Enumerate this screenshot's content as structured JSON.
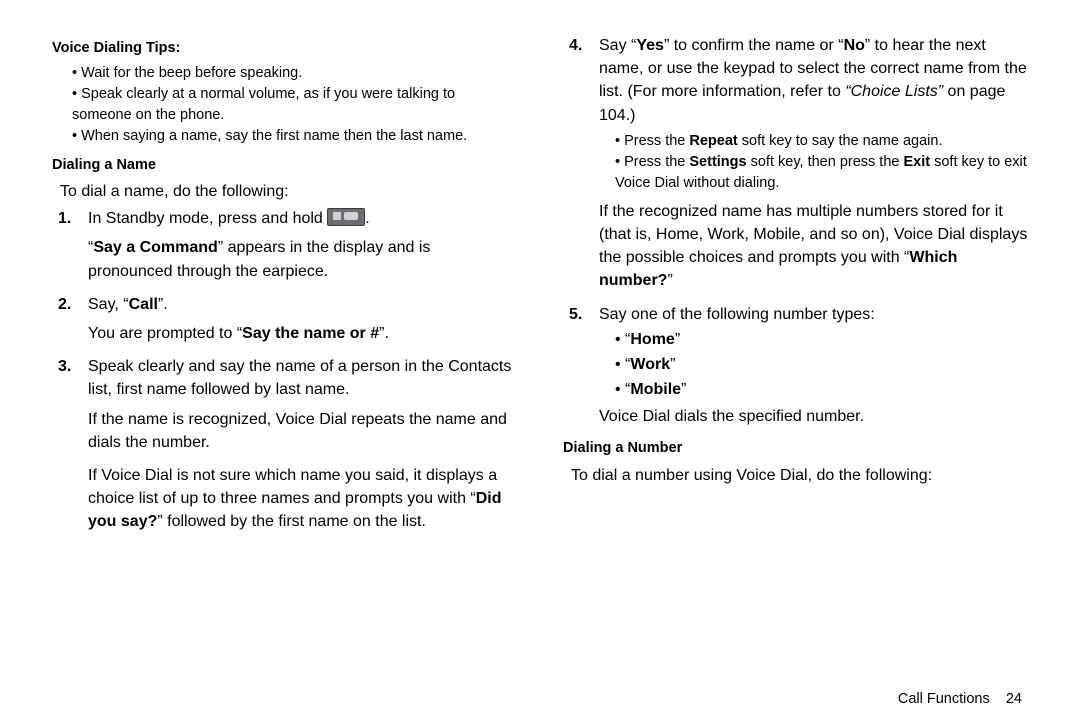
{
  "left": {
    "tips_head": "Voice Dialing Tips:",
    "tips": {
      "b1": "Wait for the beep before speaking.",
      "b2": "Speak clearly at a normal volume, as if you were talking to someone on the phone.",
      "b3": "When saying a name, say the first name then the last name."
    },
    "dial_name_head": "Dialing a Name",
    "dial_name_intro": "To dial a name, do the following:",
    "step1_a": "In Standby mode, press and hold ",
    "step1_b": ".",
    "step1_para_pre": "“",
    "step1_para_bold": "Say a Command",
    "step1_para_post": "” appears in the display and is pronounced through the earpiece.",
    "step2_a": "Say, “",
    "step2_bold": "Call",
    "step2_b": "”.",
    "step2_para_pre": "You are prompted to “",
    "step2_para_bold": "Say the name or #",
    "step2_para_post": "”.",
    "step3": "Speak clearly and say the name of a person in the Contacts list, first name followed by last name.",
    "step3_p1": "If the name is recognized, Voice Dial repeats the name and dials the number.",
    "step3_p2_a": "If Voice Dial is not sure which name you said, it displays a choice list of up to three names and prompts you with “",
    "step3_p2_bold": "Did you say?",
    "step3_p2_b": "” followed by the first name on the list."
  },
  "right": {
    "step4_a": "Say “",
    "step4_yes": "Yes",
    "step4_b": "” to confirm the name or “",
    "step4_no": "No",
    "step4_c": "” to hear the next name, or use the keypad to select the correct name from the list. (For more information, refer to ",
    "step4_ref": "“Choice Lists”",
    "step4_d": " on page 104.)",
    "sub1_a": "Press the ",
    "sub1_bold": "Repeat",
    "sub1_b": " soft key to say the name again.",
    "sub2_a": "Press the ",
    "sub2_bold1": "Settings",
    "sub2_b": " soft key, then press the ",
    "sub2_bold2": "Exit",
    "sub2_c": " soft key to exit Voice Dial without dialing.",
    "step4_p_a": "If the recognized name has multiple numbers stored for it (that is, Home, Work, Mobile, and so on), Voice Dial displays the possible choices and prompts you with “",
    "step4_p_bold": "Which number?",
    "step4_p_b": "”",
    "step5": "Say one of the following number types:",
    "opt_home": "Home",
    "opt_work": "Work",
    "opt_mobile": "Mobile",
    "step5_post": "Voice Dial dials the specified number.",
    "dial_num_head": "Dialing a Number",
    "dial_num_intro": "To dial a number using Voice Dial, do the following:"
  },
  "footer": {
    "section": "Call Functions",
    "page": "24"
  }
}
